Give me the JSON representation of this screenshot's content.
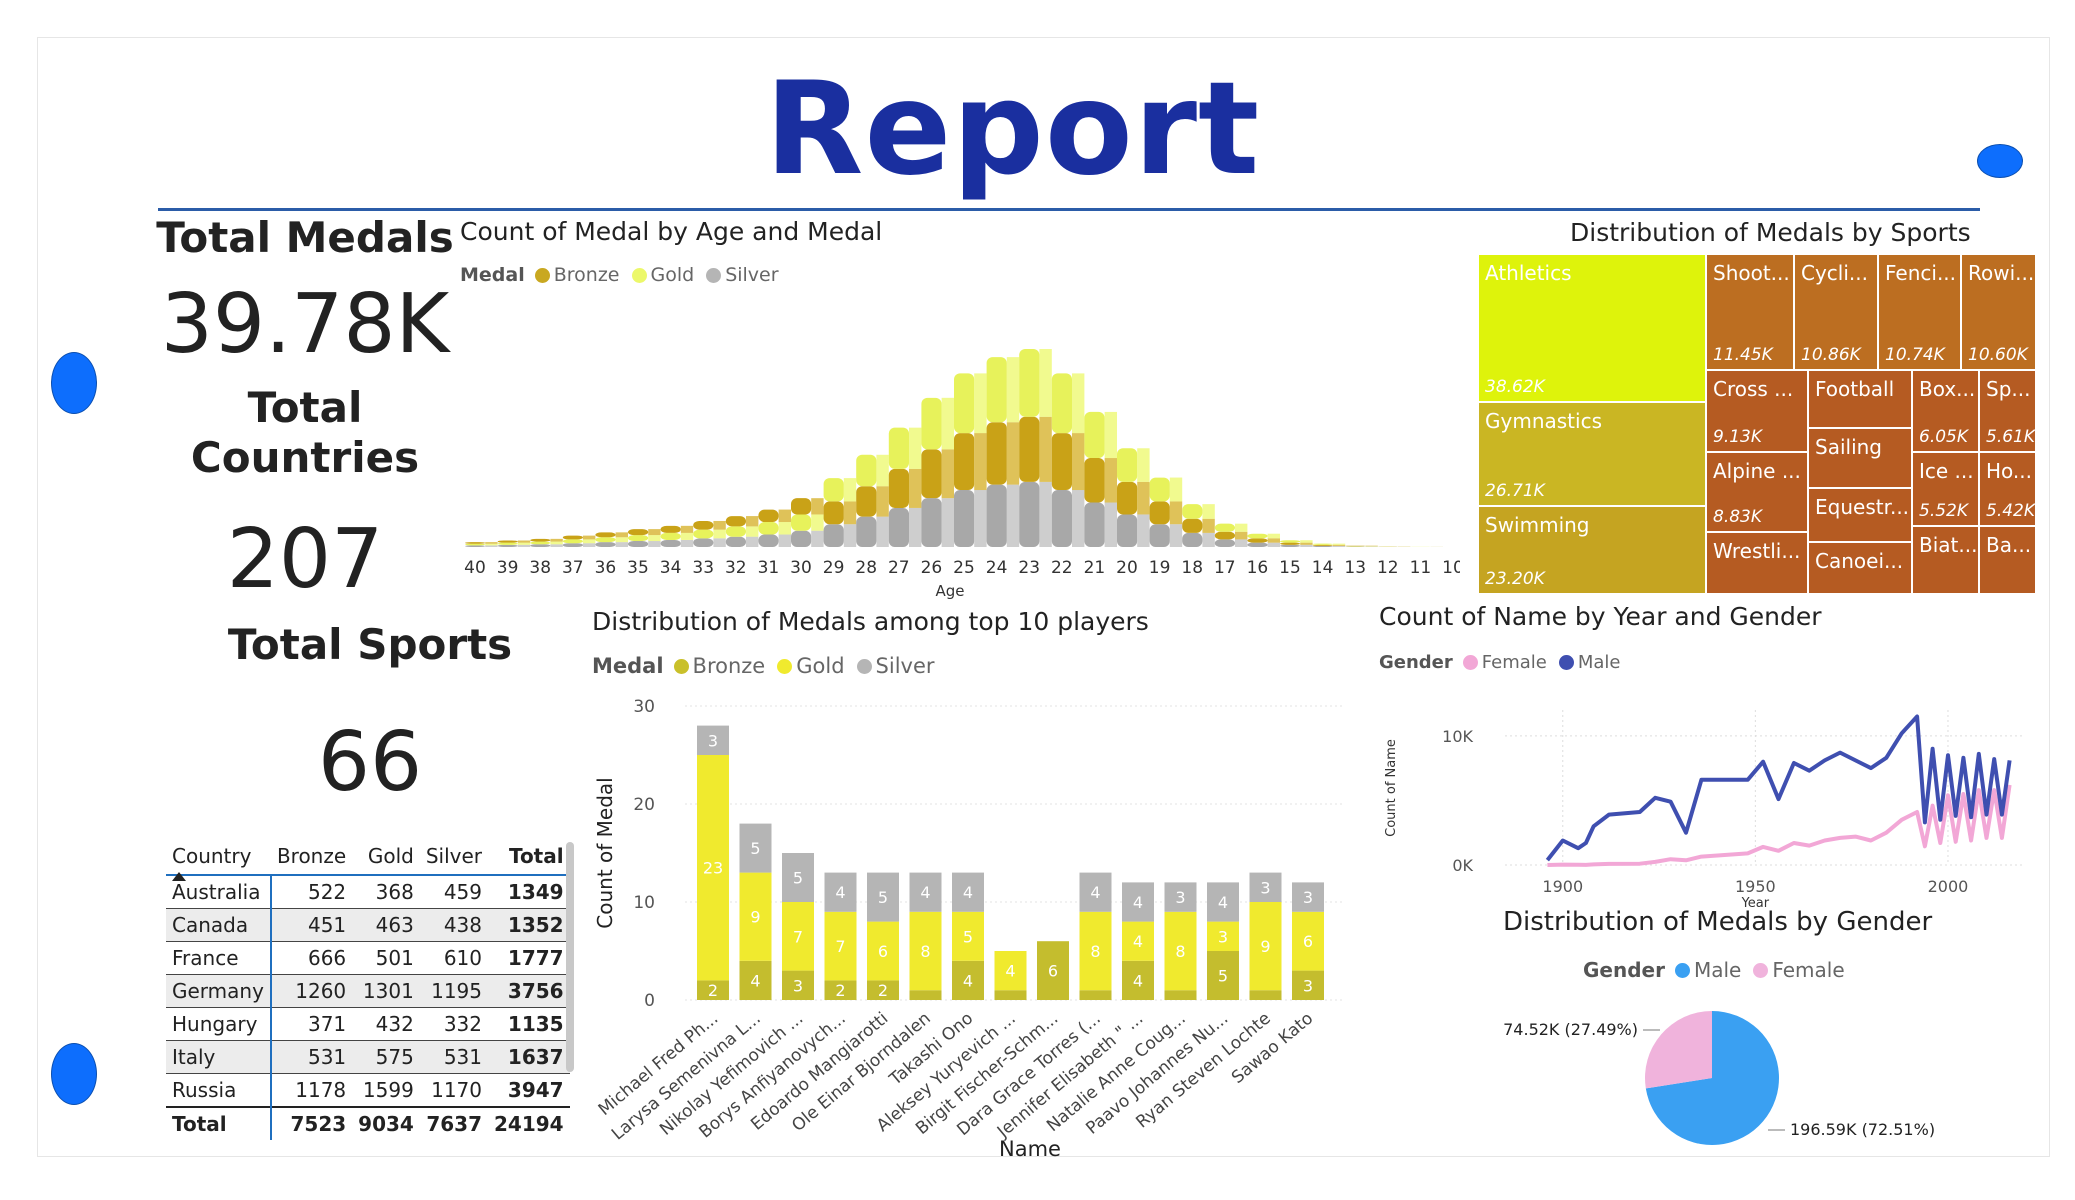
{
  "header": {
    "title": "Report"
  },
  "kpis": {
    "total_medals_label": "Total Medals",
    "total_medals_value": "39.78K",
    "total_countries_label_1": "Total",
    "total_countries_label_2": "Countries",
    "total_countries_value": "207",
    "total_sports_label": "Total Sports",
    "total_sports_value": "66"
  },
  "colors": {
    "bronze": "#c9b42a",
    "gold": "#f0ea2e",
    "silver": "#b5b5b5",
    "male": "#3f4fb0",
    "female": "#f2a7d6",
    "pie_male": "#3aa0f2",
    "pie_female": "#f0b3dc",
    "accent": "#1a2f9f"
  },
  "age_chart": {
    "title": "Count of Medal by Age and Medal",
    "legend_title": "Medal",
    "legend": [
      "Bronze",
      "Gold",
      "Silver"
    ],
    "xlabel": "Age"
  },
  "treemap": {
    "title": "Distribution of Medals by Sports",
    "items": [
      {
        "name": "Athletics",
        "value": "38.62K"
      },
      {
        "name": "Gymnastics",
        "value": "26.71K"
      },
      {
        "name": "Swimming",
        "value": "23.20K"
      },
      {
        "name": "Shoot...",
        "value": "11.45K"
      },
      {
        "name": "Cycli...",
        "value": "10.86K"
      },
      {
        "name": "Fenci...",
        "value": "10.74K"
      },
      {
        "name": "Rowi...",
        "value": "10.60K"
      },
      {
        "name": "Cross ...",
        "value": "9.13K"
      },
      {
        "name": "Football",
        "value": ""
      },
      {
        "name": "Box...",
        "value": "6.05K"
      },
      {
        "name": "Sp...",
        "value": "5.61K"
      },
      {
        "name": "Alpine ...",
        "value": "8.83K"
      },
      {
        "name": "Sailing",
        "value": ""
      },
      {
        "name": "Ice ...",
        "value": "5.52K"
      },
      {
        "name": "Ho...",
        "value": "5.42K"
      },
      {
        "name": "Equestr...",
        "value": ""
      },
      {
        "name": "Wrestli...",
        "value": ""
      },
      {
        "name": "Canoei...",
        "value": ""
      },
      {
        "name": "Biat...",
        "value": ""
      },
      {
        "name": "Ba...",
        "value": ""
      }
    ]
  },
  "players_chart": {
    "title": "Distribution of Medals among top 10 players",
    "legend_title": "Medal",
    "legend": [
      "Bronze",
      "Gold",
      "Silver"
    ],
    "xlabel": "Name",
    "ylabel": "Count of Medal"
  },
  "year_chart": {
    "title": "Count of Name by Year and Gender",
    "legend_title": "Gender",
    "legend": [
      "Female",
      "Male"
    ],
    "ylabel": "Count of Name",
    "xlabel": "Year"
  },
  "gender_pie": {
    "title": "Distribution of Medals by Gender",
    "legend_title": "Gender",
    "legend": [
      "Male",
      "Female"
    ],
    "label_female": "74.52K (27.49%)",
    "label_male": "196.59K (72.51%)"
  },
  "table": {
    "headers": [
      "Country",
      "Bronze",
      "Gold",
      "Silver",
      "Total"
    ],
    "rows": [
      [
        "Australia",
        "522",
        "368",
        "459",
        "1349"
      ],
      [
        "Canada",
        "451",
        "463",
        "438",
        "1352"
      ],
      [
        "France",
        "666",
        "501",
        "610",
        "1777"
      ],
      [
        "Germany",
        "1260",
        "1301",
        "1195",
        "3756"
      ],
      [
        "Hungary",
        "371",
        "432",
        "332",
        "1135"
      ],
      [
        "Italy",
        "531",
        "575",
        "531",
        "1637"
      ],
      [
        "Russia",
        "1178",
        "1599",
        "1170",
        "3947"
      ]
    ],
    "total": [
      "Total",
      "7523",
      "9034",
      "7637",
      "24194"
    ]
  },
  "chart_data": [
    {
      "type": "area",
      "title": "Count of Medal by Age and Medal",
      "xlabel": "Age",
      "ylabel": "",
      "categories": [
        "40",
        "39",
        "38",
        "37",
        "36",
        "35",
        "34",
        "33",
        "32",
        "31",
        "30",
        "29",
        "28",
        "27",
        "26",
        "25",
        "24",
        "23",
        "22",
        "21",
        "20",
        "19",
        "18",
        "17",
        "16",
        "15",
        "14",
        "13",
        "12",
        "11",
        "10"
      ],
      "series": [
        {
          "name": "Bronze",
          "values": [
            30,
            40,
            50,
            70,
            90,
            110,
            130,
            160,
            190,
            230,
            300,
            420,
            560,
            720,
            900,
            1050,
            1150,
            1200,
            1050,
            820,
            600,
            420,
            260,
            140,
            80,
            40,
            20,
            8,
            3,
            1,
            0
          ]
        },
        {
          "name": "Gold",
          "values": [
            30,
            40,
            50,
            70,
            90,
            110,
            130,
            160,
            190,
            230,
            300,
            430,
            580,
            760,
            950,
            1100,
            1200,
            1250,
            1100,
            850,
            620,
            440,
            270,
            150,
            85,
            45,
            22,
            8,
            3,
            1,
            0
          ]
        },
        {
          "name": "Silver",
          "values": [
            30,
            40,
            50,
            70,
            90,
            110,
            130,
            160,
            190,
            230,
            300,
            420,
            560,
            720,
            900,
            1050,
            1150,
            1200,
            1050,
            820,
            600,
            420,
            260,
            140,
            80,
            40,
            20,
            8,
            3,
            1,
            0
          ]
        }
      ]
    },
    {
      "type": "bar",
      "title": "Distribution of Medals among top 10 players",
      "xlabel": "Name",
      "ylabel": "Count of Medal",
      "ylim": [
        0,
        30
      ],
      "yticks": [
        0,
        10,
        20,
        30
      ],
      "categories": [
        "Michael Fred Ph...",
        "Larysa Semenivna L...",
        "Nikolay Yefimovich ...",
        "Borys Anfiyanovych...",
        "Edoardo Mangiarotti",
        "Ole Einar Bjorndalen",
        "Takashi Ono",
        "Aleksey Yuryevich ...",
        "Birgit Fischer-Schm...",
        "Dara Grace Torres (...",
        "Jennifer Elisabeth \" ...",
        "Natalie Anne Coug...",
        "Paavo Johannes Nu...",
        "Ryan Steven Lochte",
        "Sawao Kato"
      ],
      "series": [
        {
          "name": "Bronze",
          "values": [
            2,
            4,
            3,
            2,
            2,
            1,
            4,
            1,
            6,
            1,
            4,
            1,
            5,
            1,
            3
          ]
        },
        {
          "name": "Gold",
          "values": [
            23,
            9,
            7,
            7,
            6,
            8,
            5,
            4,
            0,
            8,
            4,
            8,
            3,
            9,
            6
          ]
        },
        {
          "name": "Silver",
          "values": [
            3,
            5,
            5,
            4,
            5,
            4,
            4,
            0,
            0,
            4,
            4,
            3,
            4,
            3,
            3
          ]
        }
      ],
      "stacked": true
    },
    {
      "type": "line",
      "title": "Count of Name by Year and Gender",
      "xlabel": "Year",
      "ylabel": "Count of Name",
      "yticks": [
        "0K",
        "10K"
      ],
      "xticks": [
        "1900",
        "1950",
        "2000"
      ],
      "x": [
        1896,
        1900,
        1904,
        1906,
        1908,
        1912,
        1920,
        1924,
        1928,
        1932,
        1936,
        1948,
        1952,
        1956,
        1960,
        1964,
        1968,
        1972,
        1976,
        1980,
        1984,
        1988,
        1992,
        1994,
        1996,
        1998,
        2000,
        2002,
        2004,
        2006,
        2008,
        2010,
        2012,
        2014,
        2016
      ],
      "series": [
        {
          "name": "Male",
          "values": [
            380,
            1900,
            1300,
            1700,
            3000,
            3900,
            4100,
            5200,
            4900,
            2500,
            6600,
            6600,
            8000,
            5100,
            7900,
            7300,
            8100,
            8700,
            8100,
            7500,
            8300,
            10200,
            11500,
            3300,
            9000,
            3500,
            8500,
            3800,
            8300,
            3700,
            8600,
            3900,
            8200,
            3900,
            8100
          ]
        },
        {
          "name": "Female",
          "values": [
            0,
            30,
            16,
            10,
            45,
            85,
            100,
            240,
            450,
            360,
            650,
            900,
            1400,
            1100,
            1700,
            1500,
            1900,
            2100,
            2200,
            1900,
            2500,
            3500,
            4100,
            1450,
            4600,
            1700,
            5400,
            1800,
            5500,
            1900,
            5800,
            2100,
            5800,
            2100,
            6200
          ]
        }
      ]
    },
    {
      "type": "pie",
      "title": "Distribution of Medals by Gender",
      "categories": [
        "Male",
        "Female"
      ],
      "values": [
        196590,
        74520
      ],
      "labels": [
        "196.59K (72.51%)",
        "74.52K (27.49%)"
      ]
    },
    {
      "type": "table",
      "title": "",
      "columns": [
        "Country",
        "Bronze",
        "Gold",
        "Silver",
        "Total"
      ]
    }
  ]
}
